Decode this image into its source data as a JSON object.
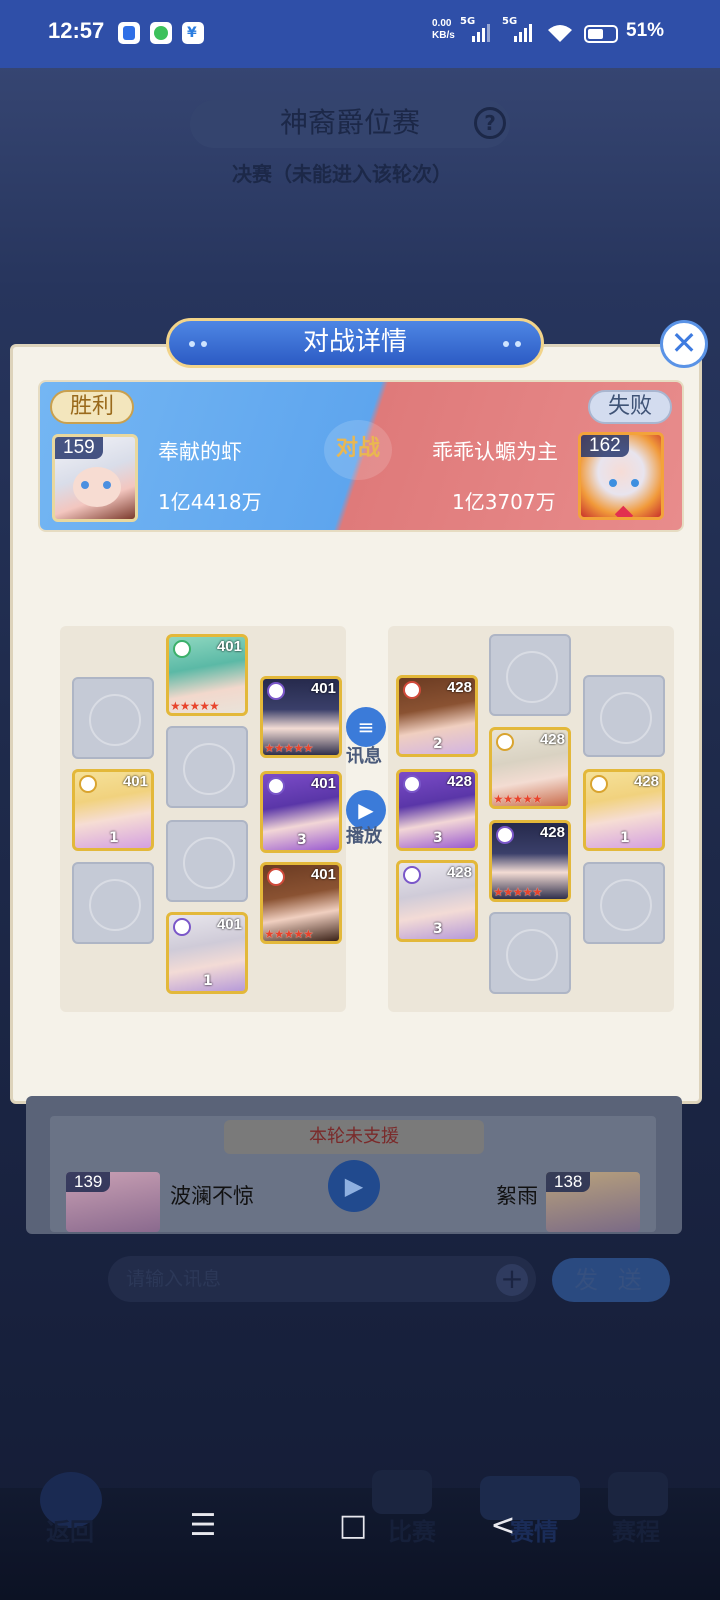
{
  "status_bar": {
    "time": "12:57",
    "net_speed": "0.00",
    "net_unit": "KB/s",
    "sim1": "5G",
    "sim2": "5G",
    "battery": "51%"
  },
  "background": {
    "title": "神裔爵位赛",
    "subtitle": "决赛（未能进入该轮次）"
  },
  "dialog": {
    "title": "对战详情",
    "vs_label": "对战",
    "left": {
      "result": "胜利",
      "level": "159",
      "name": "奉献的虾",
      "power": "1亿4418万"
    },
    "right": {
      "result": "失败",
      "level": "162",
      "name": "乖乖认螈为主",
      "power": "1亿3707万"
    },
    "left_heroes": [
      {
        "level": "401",
        "star_count": 5,
        "stars": "★★★★★",
        "num": ""
      },
      {
        "level": "401",
        "star_count": 5,
        "stars": "★★★★★",
        "num": ""
      },
      {
        "level": "401",
        "star_count": 0,
        "stars": "",
        "num": "1"
      },
      {
        "level": "401",
        "star_count": 0,
        "stars": "",
        "num": "3"
      },
      {
        "level": "401",
        "star_count": 5,
        "stars": "★★★★★",
        "num": ""
      },
      {
        "level": "401",
        "star_count": 0,
        "stars": "",
        "num": "1"
      }
    ],
    "right_heroes": [
      {
        "level": "428",
        "star_count": 0,
        "stars": "",
        "num": "2"
      },
      {
        "level": "428",
        "star_count": 5,
        "stars": "★★★★★",
        "num": ""
      },
      {
        "level": "428",
        "star_count": 0,
        "stars": "",
        "num": "3"
      },
      {
        "level": "428",
        "star_count": 0,
        "stars": "",
        "num": "1"
      },
      {
        "level": "428",
        "star_count": 5,
        "stars": "★★★★★",
        "num": ""
      },
      {
        "level": "428",
        "star_count": 0,
        "stars": "",
        "num": "3"
      }
    ],
    "message_label": "讯息",
    "play_label": "播放"
  },
  "lower_panel": {
    "no_support": "本轮未支援",
    "left": {
      "level": "139",
      "name": "波澜不惊"
    },
    "right": {
      "level": "138",
      "name": "絮雨"
    }
  },
  "chat": {
    "placeholder": "请输入讯息",
    "send_label": "发 送"
  },
  "game_nav": {
    "back": "返回",
    "match": "比赛",
    "detail": "赛情",
    "schedule": "赛程"
  },
  "colors": {
    "accent": "#3b7bd9",
    "win": "#5ea5ee",
    "lose": "#e07c7c",
    "gold": "#e3b83a"
  }
}
